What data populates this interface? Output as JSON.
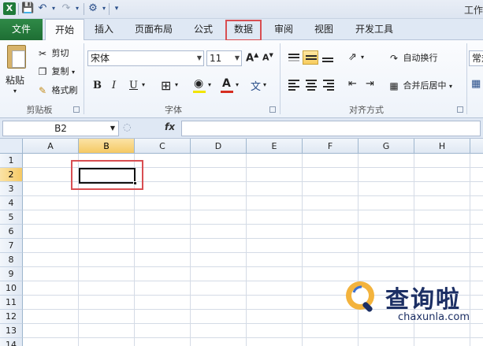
{
  "app": {
    "title_fragment": "工作"
  },
  "tabs": [
    {
      "label": "文件"
    },
    {
      "label": "开始"
    },
    {
      "label": "插入"
    },
    {
      "label": "页面布局"
    },
    {
      "label": "公式"
    },
    {
      "label": "数据"
    },
    {
      "label": "审阅"
    },
    {
      "label": "视图"
    },
    {
      "label": "开发工具"
    }
  ],
  "ribbon": {
    "clipboard": {
      "paste": "粘贴",
      "cut": "剪切",
      "copy": "复制",
      "format_painter": "格式刷",
      "group": "剪贴板"
    },
    "font": {
      "name": "宋体",
      "size": "11",
      "bold": "B",
      "italic": "I",
      "underline": "U",
      "group": "字体"
    },
    "alignment": {
      "wrap_text": "自动换行",
      "merge_center": "合并后居中",
      "group": "对齐方式"
    },
    "number": {
      "format_fragment": "常规"
    }
  },
  "formula_bar": {
    "name_box": "B2",
    "fx": "fx",
    "value": ""
  },
  "grid": {
    "columns": [
      "A",
      "B",
      "C",
      "D",
      "E",
      "F",
      "G",
      "H"
    ],
    "rows": [
      "1",
      "2",
      "3",
      "4",
      "5",
      "6",
      "7",
      "8",
      "9",
      "10",
      "11",
      "12",
      "13",
      "14"
    ],
    "selected_cell": "B2"
  },
  "watermark": {
    "text": "查询啦",
    "url": "chaxunla.com"
  }
}
